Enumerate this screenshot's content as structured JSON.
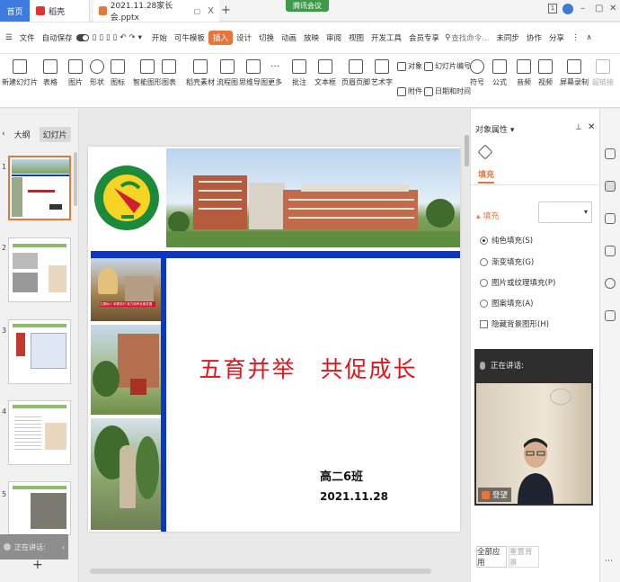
{
  "titlebar": {
    "home_tab": "首页",
    "daoke_tab": "稻壳",
    "doc_tab": "2021.11.28家长会.pptx",
    "meeting_label": "腾讯会议",
    "close_x": "X",
    "plus": "+"
  },
  "menu": {
    "file": "文件",
    "autosave": "自动保存",
    "items": [
      "开始",
      "可牛模板",
      "插入",
      "设计",
      "切换",
      "动画",
      "放映",
      "审阅",
      "视图",
      "开发工具",
      "会员专享"
    ],
    "active_index": 2,
    "search": "查找命令...",
    "sync": "未同步",
    "collab": "协作",
    "share": "分享"
  },
  "ribbon": {
    "items": [
      "新建幻灯片",
      "表格",
      "图片",
      "形状",
      "图标",
      "智能图形",
      "图表",
      "稻壳素材",
      "流程图",
      "思维导图",
      "更多",
      "批注",
      "文本框",
      "页眉页脚",
      "艺术字",
      "对象",
      "幻灯片编号",
      "附件",
      "日期和时间",
      "符号",
      "公式",
      "音频",
      "视频",
      "屏幕录制",
      "超链接"
    ]
  },
  "leftpanel": {
    "tabs": [
      "大纲",
      "幻灯片"
    ],
    "slide_numbers": [
      "1",
      "2",
      "3",
      "4",
      "5"
    ],
    "speaking": "正在讲话:",
    "plus": "+"
  },
  "slide": {
    "title": "五育并举　共促成长",
    "class_label": "高二6班",
    "date": "2021.11.28",
    "photo_caption": "立德树人 砥砺前行 致力培养全面发展"
  },
  "props": {
    "title": "对象属性",
    "fill_tab": "填充",
    "fill_section": "填充",
    "options": [
      "纯色填充(S)",
      "渐变填充(G)",
      "图片或纹理填充(P)",
      "图案填充(A)"
    ],
    "selected_option": 0,
    "hide_bg": "隐藏背景图形(H)",
    "apply_all": "全部应用",
    "reset_bg": "重置背景"
  },
  "video": {
    "speaking": "正在讲话:",
    "name": "登望"
  },
  "colors": {
    "accent": "#e8753a",
    "slide_blue": "#0b36c6",
    "title_red": "#e0141a",
    "home_blue": "#3d7be0"
  }
}
